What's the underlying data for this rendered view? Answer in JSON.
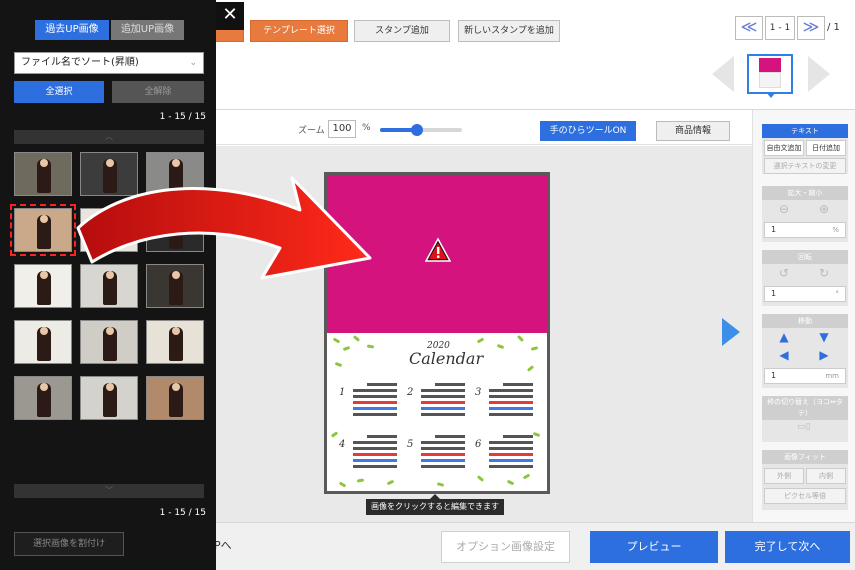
{
  "top_buttons": [
    {
      "label": "テンプレート選択"
    },
    {
      "label": "スタンプ追加"
    },
    {
      "label": "新しいスタンプを追加"
    }
  ],
  "pager": {
    "prev": "≪",
    "current": "1 - 1",
    "next": "≫",
    "total": "/ 1"
  },
  "toolbar": {
    "zoom_label": "ズーム",
    "zoom_value": "100",
    "zoom_unit": "%",
    "zoom_slider_fraction": 0.45,
    "hand_tool": "手のひらツールON",
    "product_info": "商品情報"
  },
  "canvas": {
    "photo_slot_color": "#d4137f",
    "calendar_year": "2020",
    "calendar_title": "Calendar",
    "months": [
      "1",
      "2",
      "3",
      "4",
      "5",
      "6"
    ],
    "hint": "画像をクリックすると編集できます"
  },
  "right_panel": {
    "text_header": "テキスト",
    "free_text": "自由文追加",
    "date_add": "日付追加",
    "change_text": "選択テキストの変更",
    "scale_header": "拡大・縮小",
    "scale_value": "1",
    "scale_unit": "%",
    "rotate_header": "回転",
    "rotate_value": "1",
    "rotate_unit": "°",
    "move_header": "移動",
    "move_value": "1",
    "move_unit": "mm",
    "frame_header": "枠の切り替え（ヨコ⇔タテ）",
    "fit_header": "画像フィット",
    "fit_outer": "外側",
    "fit_inner": "内側",
    "pixel_equal": "ピクセル等倍"
  },
  "bottom": {
    "save_top": "保存してTOPへ",
    "option_image": "オプション画像設定",
    "preview": "プレビュー",
    "finish_next": "完了して次へ"
  },
  "overlay": {
    "tab_past": "過去UP画像",
    "tab_added": "追加UP画像",
    "close": "✕",
    "sort": "ファイル名でソート(昇順)",
    "select_all": "全選択",
    "deselect_all": "全解除",
    "count_top": "1 - 15 / 15",
    "count_bottom": "1 - 15 / 15",
    "attach": "選択画像を割付け"
  },
  "colors": {
    "accent_blue": "#2e6fe0",
    "orange": "#e87a3e",
    "magenta": "#d4137f",
    "selection_red": "#ff2020"
  }
}
